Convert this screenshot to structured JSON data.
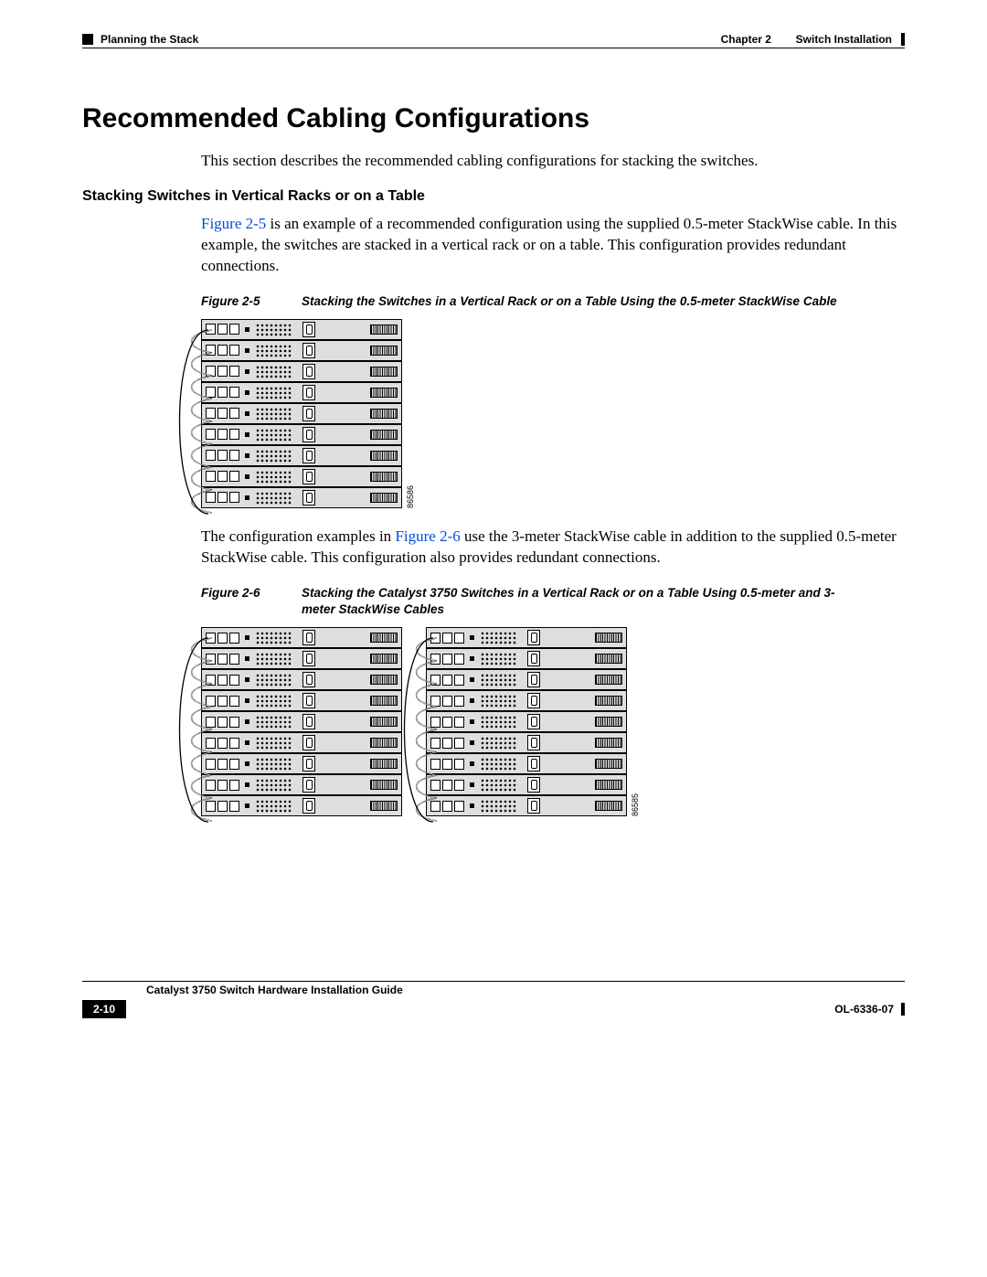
{
  "header": {
    "left_section": "Planning the Stack",
    "chapter_label": "Chapter 2",
    "chapter_title": "Switch Installation"
  },
  "section": {
    "title": "Recommended Cabling Configurations",
    "intro": "This section describes the recommended cabling configurations for stacking the switches."
  },
  "sub1": {
    "heading": "Stacking Switches in Vertical Racks or on a Table",
    "para_ref": "Figure 2-5",
    "para_rest": " is an example of a recommended configuration using the supplied 0.5-meter StackWise cable. In this example, the switches are stacked in a vertical rack or on a table. This configuration provides redundant connections."
  },
  "fig25": {
    "num": "Figure 2-5",
    "caption": "Stacking the Switches in a Vertical Rack or on a Table Using the 0.5-meter StackWise Cable",
    "image_id": "86586"
  },
  "mid": {
    "pre": "The configuration examples in ",
    "ref": "Figure 2-6",
    "post": " use the 3-meter StackWise cable in addition to the supplied 0.5-meter StackWise cable. This configuration also provides redundant connections."
  },
  "fig26": {
    "num": "Figure 2-6",
    "caption": "Stacking the Catalyst 3750 Switches in a Vertical Rack or on a Table Using 0.5-meter and 3-meter StackWise Cables",
    "image_id": "86585"
  },
  "footer": {
    "guide": "Catalyst 3750 Switch Hardware Installation Guide",
    "page": "2-10",
    "docid": "OL-6336-07"
  }
}
